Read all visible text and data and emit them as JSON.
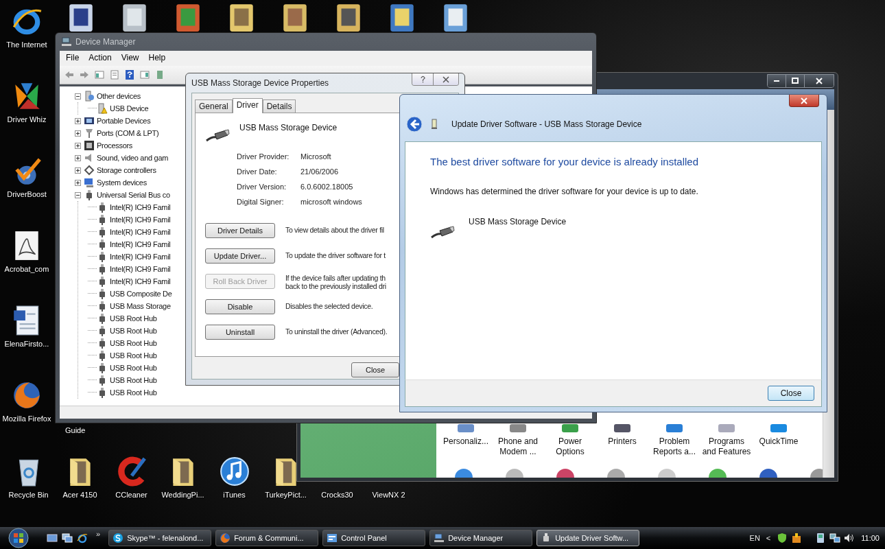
{
  "desktop": {
    "left_icons": [
      {
        "label": "The Internet",
        "kind": "globe"
      },
      {
        "label": "Driver Whiz",
        "kind": "app"
      },
      {
        "label": "DriverBoost",
        "kind": "gear"
      },
      {
        "label": "Acrobat_com",
        "kind": "pdf"
      },
      {
        "label": "ElenaFirsto...",
        "kind": "doc"
      },
      {
        "label": "Mozilla Firefox",
        "kind": "fox"
      }
    ],
    "bottom_icons": [
      {
        "label": "Recycle Bin",
        "kind": "bin"
      },
      {
        "label": "Acer 4150",
        "kind": "folder"
      },
      {
        "label": "CCleaner",
        "kind": "cleaner"
      },
      {
        "label": "WeddingPi...",
        "kind": "folder"
      },
      {
        "label": "iTunes",
        "kind": "music"
      },
      {
        "label": "TurkeyPict...",
        "kind": "folder"
      },
      {
        "label": "Crocks30",
        "kind": "none"
      },
      {
        "label": "ViewNX 2",
        "kind": "none"
      }
    ],
    "partial_labels": [
      "Guide"
    ]
  },
  "control_panel": {
    "items": [
      {
        "label": "Personaliz..."
      },
      {
        "label": "Phone and Modem ..."
      },
      {
        "label": "Power Options"
      },
      {
        "label": "Printers"
      },
      {
        "label": "Problem Reports a..."
      },
      {
        "label": "Programs and Features"
      },
      {
        "label": "QuickTime"
      }
    ]
  },
  "device_manager": {
    "title": "Device Manager",
    "menu": [
      "File",
      "Action",
      "View",
      "Help"
    ],
    "tree": [
      {
        "label": "Other devices",
        "kind": "unknown",
        "expanded": true,
        "children": [
          {
            "label": "USB Device",
            "kind": "warning"
          }
        ]
      },
      {
        "label": "Portable Devices",
        "kind": "portable",
        "expanded": false
      },
      {
        "label": "Ports (COM & LPT)",
        "kind": "port",
        "expanded": false
      },
      {
        "label": "Processors",
        "kind": "chip",
        "expanded": false
      },
      {
        "label": "Sound, video and gam",
        "kind": "sound",
        "expanded": false
      },
      {
        "label": "Storage controllers",
        "kind": "storage",
        "expanded": false
      },
      {
        "label": "System devices",
        "kind": "system",
        "expanded": false
      },
      {
        "label": "Universal Serial Bus co",
        "kind": "usb",
        "expanded": true,
        "children": [
          {
            "label": "Intel(R) ICH9 Famil",
            "kind": "usb"
          },
          {
            "label": "Intel(R) ICH9 Famil",
            "kind": "usb"
          },
          {
            "label": "Intel(R) ICH9 Famil",
            "kind": "usb"
          },
          {
            "label": "Intel(R) ICH9 Famil",
            "kind": "usb"
          },
          {
            "label": "Intel(R) ICH9 Famil",
            "kind": "usb"
          },
          {
            "label": "Intel(R) ICH9 Famil",
            "kind": "usb"
          },
          {
            "label": "Intel(R) ICH9 Famil",
            "kind": "usb"
          },
          {
            "label": "USB Composite De",
            "kind": "usb"
          },
          {
            "label": "USB Mass Storage",
            "kind": "usb"
          },
          {
            "label": "USB Root Hub",
            "kind": "usb"
          },
          {
            "label": "USB Root Hub",
            "kind": "usb"
          },
          {
            "label": "USB Root Hub",
            "kind": "usb"
          },
          {
            "label": "USB Root Hub",
            "kind": "usb"
          },
          {
            "label": "USB Root Hub",
            "kind": "usb"
          },
          {
            "label": "USB Root Hub",
            "kind": "usb"
          },
          {
            "label": "USB Root Hub",
            "kind": "usb"
          }
        ]
      }
    ]
  },
  "properties": {
    "title": "USB Mass Storage Device Properties",
    "tabs": [
      {
        "label": "General",
        "selected": false
      },
      {
        "label": "Driver",
        "selected": true
      },
      {
        "label": "Details",
        "selected": false
      }
    ],
    "device_name": "USB Mass Storage Device",
    "fields": [
      {
        "label": "Driver Provider:",
        "value": "Microsoft"
      },
      {
        "label": "Driver Date:",
        "value": "21/06/2006"
      },
      {
        "label": "Driver Version:",
        "value": "6.0.6002.18005"
      },
      {
        "label": "Digital Signer:",
        "value": "microsoft windows"
      }
    ],
    "actions": [
      {
        "button": "Driver Details",
        "disabled": false,
        "description": "To view details about the driver fil"
      },
      {
        "button": "Update Driver...",
        "disabled": false,
        "description": "To update the driver software for t"
      },
      {
        "button": "Roll Back Driver",
        "disabled": true,
        "description": "If the device fails after updating th back to the previously installed dri"
      },
      {
        "button": "Disable",
        "disabled": false,
        "description": "Disables the selected device."
      },
      {
        "button": "Uninstall",
        "disabled": false,
        "description": "To uninstall the driver (Advanced)."
      }
    ],
    "close": "Close"
  },
  "update_driver": {
    "title": "Update Driver Software - USB Mass Storage Device",
    "heading": "The best driver software for your device is already installed",
    "message": "Windows has determined the driver software for your device is up to date.",
    "device_name": "USB Mass Storage Device",
    "close": "Close"
  },
  "taskbar": {
    "tasks": [
      {
        "label": "Skype™ - felenalond...",
        "kind": "skype",
        "selected": false
      },
      {
        "label": "Forum & Communi...",
        "kind": "fox",
        "selected": false
      },
      {
        "label": "Control Panel",
        "kind": "panel",
        "selected": false
      },
      {
        "label": "Device Manager",
        "kind": "devices",
        "selected": false
      },
      {
        "label": "Update Driver Softw...",
        "kind": "usb",
        "selected": true
      }
    ],
    "overflow": "»",
    "language": "EN",
    "tray_chevron": "<",
    "clock": "11:00"
  }
}
